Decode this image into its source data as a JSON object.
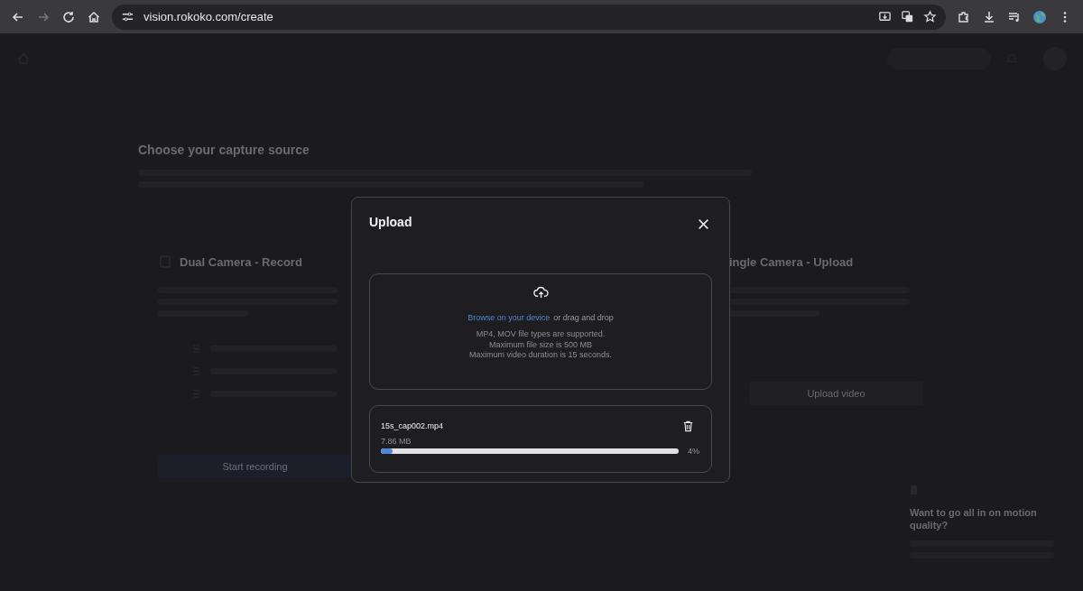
{
  "browser": {
    "url": "vision.rokoko.com/create",
    "forward_disabled": true
  },
  "page": {
    "title": "Choose your capture source",
    "cards": [
      {
        "kind": "record",
        "title": "Dual Camera - Record",
        "button": "Start recording"
      },
      {
        "kind": "upload",
        "title": "ingle Camera - Upload",
        "button": "Upload video"
      }
    ],
    "promo": {
      "title": "Want to go all in on motion quality?"
    }
  },
  "dialog": {
    "title": "Upload",
    "link": "Browse on your device",
    "link_rest": "or drag and drop",
    "info": [
      "MP4, MOV file types are supported.",
      "Maximum file size is 500 MB",
      "Maximum video duration is 15 seconds."
    ],
    "file": {
      "name": "15s_cap002.mp4",
      "size": "7.86 MB",
      "level": 0.04,
      "percent": "4%"
    }
  }
}
